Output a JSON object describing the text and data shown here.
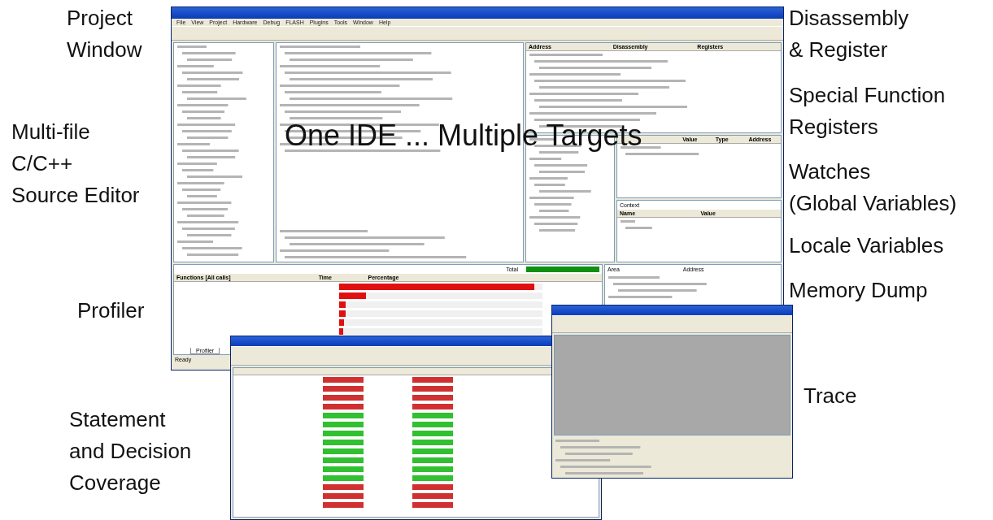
{
  "labels_left": [
    {
      "lines": [
        "Project",
        "Window"
      ]
    },
    {
      "lines": [
        "Multi-file",
        "C/C++",
        "Source Editor"
      ]
    },
    {
      "lines": [
        "Profiler"
      ]
    },
    {
      "lines": [
        "Statement",
        "and Decision",
        "Coverage"
      ]
    }
  ],
  "labels_right": [
    {
      "lines": [
        "Disassembly",
        "& Register"
      ]
    },
    {
      "lines": [
        "Special Function",
        "Registers"
      ]
    },
    {
      "lines": [
        "Watches",
        "(Global Variables)"
      ]
    },
    {
      "lines": [
        "Locale Variables"
      ]
    },
    {
      "lines": [
        "Memory Dump"
      ]
    },
    {
      "lines": [
        "Trace"
      ]
    }
  ],
  "caption": "One IDE ... Multiple Targets",
  "ide": {
    "menu": [
      "File",
      "View",
      "Project",
      "Hardware",
      "Debug",
      "FLASH",
      "Plugins",
      "Tools",
      "Window",
      "Help"
    ],
    "disassembly": {
      "columns": [
        "Address",
        "Disassembly"
      ],
      "registers_title": "Registers"
    },
    "watches": {
      "columns": [
        "Value",
        "Type",
        "Address"
      ]
    },
    "locals": {
      "context_label": "Context",
      "columns": [
        "Name",
        "Value"
      ]
    },
    "profiler": {
      "columns": [
        "Functions [All calls]",
        "Time",
        "Percentage"
      ],
      "total_label": "Total",
      "tab": "Profiler",
      "rows": [
        {
          "level": 0.96
        },
        {
          "level": 0.13
        },
        {
          "level": 0.03
        },
        {
          "level": 0.03
        },
        {
          "level": 0.025
        },
        {
          "level": 0.02
        }
      ]
    },
    "memory": {
      "area_label": "Area",
      "address_label": "Address"
    },
    "status": "Ready"
  },
  "coverage": {
    "rows": [
      {
        "color": "#d03030"
      },
      {
        "color": "#d03030"
      },
      {
        "color": "#d03030"
      },
      {
        "color": "#d03030"
      },
      {
        "color": "#30c030"
      },
      {
        "color": "#30c030"
      },
      {
        "color": "#30c030"
      },
      {
        "color": "#30c030"
      },
      {
        "color": "#30c030"
      },
      {
        "color": "#30c030"
      },
      {
        "color": "#30c030"
      },
      {
        "color": "#30c030"
      },
      {
        "color": "#d03030"
      },
      {
        "color": "#d03030"
      },
      {
        "color": "#d03030"
      }
    ]
  }
}
